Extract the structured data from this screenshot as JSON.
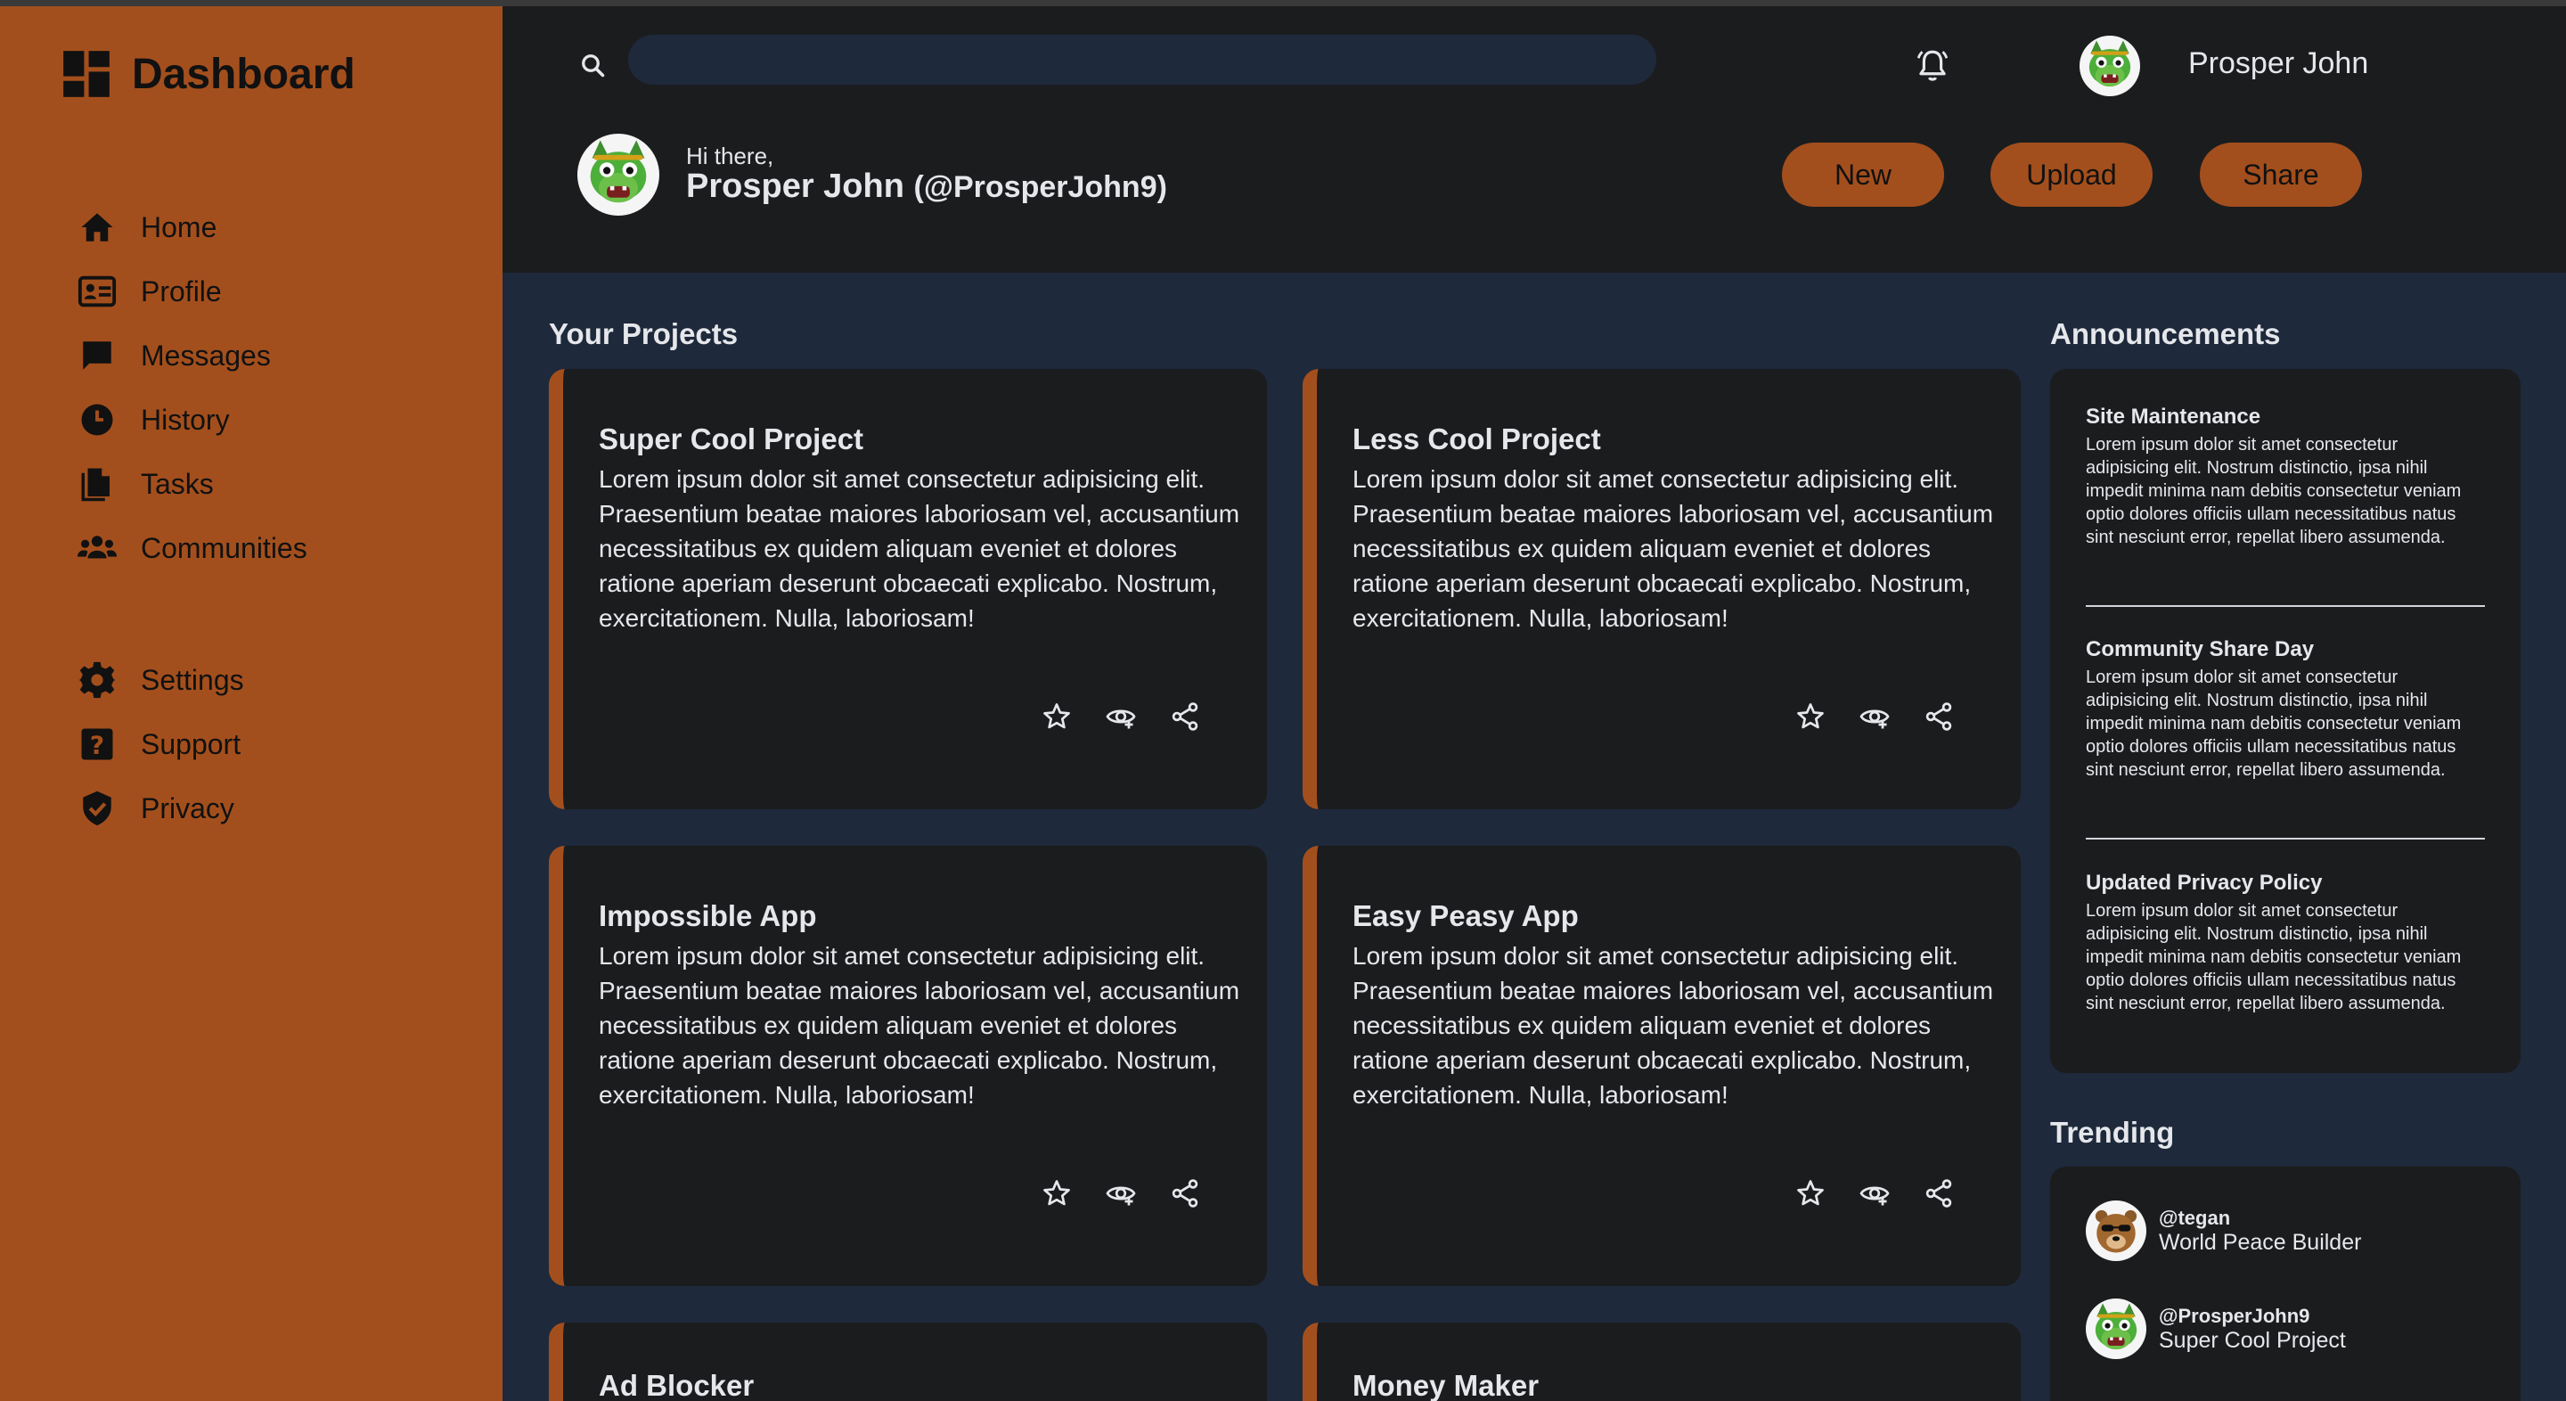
{
  "brand": {
    "title": "Dashboard",
    "icon": "dashboard-grid-icon"
  },
  "nav": {
    "primary": [
      {
        "label": "Home",
        "icon": "home-icon"
      },
      {
        "label": "Profile",
        "icon": "id-card-icon"
      },
      {
        "label": "Messages",
        "icon": "message-icon"
      },
      {
        "label": "History",
        "icon": "clock-icon"
      },
      {
        "label": "Tasks",
        "icon": "document-icon"
      },
      {
        "label": "Communities",
        "icon": "users-icon"
      }
    ],
    "secondary": [
      {
        "label": "Settings",
        "icon": "gear-icon"
      },
      {
        "label": "Support",
        "icon": "help-icon"
      },
      {
        "label": "Privacy",
        "icon": "shield-icon"
      }
    ]
  },
  "header": {
    "search_placeholder": "",
    "user_name": "Prosper John",
    "greeting": "Hi there,",
    "full_name": "Prosper John",
    "handle": "(@ProsperJohn9)",
    "buttons": {
      "new": "New",
      "upload": "Upload",
      "share": "Share"
    }
  },
  "projects": {
    "title": "Your Projects",
    "items": [
      {
        "title": "Super Cool Project",
        "body": "Lorem ipsum dolor sit amet consectetur adipisicing elit. Praesentium beatae maiores laboriosam vel, accusantium necessitatibus ex quidem aliquam eveniet et dolores ratione aperiam deserunt obcaecati explicabo. Nostrum, exercitationem. Nulla, laboriosam!"
      },
      {
        "title": "Less Cool Project",
        "body": "Lorem ipsum dolor sit amet consectetur adipisicing elit. Praesentium beatae maiores laboriosam vel, accusantium necessitatibus ex quidem aliquam eveniet et dolores ratione aperiam deserunt obcaecati explicabo. Nostrum, exercitationem. Nulla, laboriosam!"
      },
      {
        "title": "Impossible App",
        "body": "Lorem ipsum dolor sit amet consectetur adipisicing elit. Praesentium beatae maiores laboriosam vel, accusantium necessitatibus ex quidem aliquam eveniet et dolores ratione aperiam deserunt obcaecati explicabo. Nostrum, exercitationem. Nulla, laboriosam!"
      },
      {
        "title": "Easy Peasy App",
        "body": "Lorem ipsum dolor sit amet consectetur adipisicing elit. Praesentium beatae maiores laboriosam vel, accusantium necessitatibus ex quidem aliquam eveniet et dolores ratione aperiam deserunt obcaecati explicabo. Nostrum, exercitationem. Nulla, laboriosam!"
      },
      {
        "title": "Ad Blocker",
        "body": ""
      },
      {
        "title": "Money Maker",
        "body": ""
      }
    ]
  },
  "announcements": {
    "title": "Announcements",
    "items": [
      {
        "title": "Site Maintenance",
        "body": "Lorem ipsum dolor sit amet consectetur adipisicing elit. Nostrum distinctio, ipsa nihil impedit minima nam debitis consectetur veniam optio dolores officiis ullam necessitatibus natus sint nesciunt error, repellat libero assumenda."
      },
      {
        "title": "Community Share Day",
        "body": "Lorem ipsum dolor sit amet consectetur adipisicing elit. Nostrum distinctio, ipsa nihil impedit minima nam debitis consectetur veniam optio dolores officiis ullam necessitatibus natus sint nesciunt error, repellat libero assumenda."
      },
      {
        "title": "Updated Privacy Policy",
        "body": "Lorem ipsum dolor sit amet consectetur adipisicing elit. Nostrum distinctio, ipsa nihil impedit minima nam debitis consectetur veniam optio dolores officiis ullam necessitatibus natus sint nesciunt error, repellat libero assumenda."
      }
    ]
  },
  "trending": {
    "title": "Trending",
    "items": [
      {
        "handle": "@tegan",
        "desc": "World Peace Builder"
      },
      {
        "handle": "@ProsperJohn9",
        "desc": "Super Cool Project"
      }
    ]
  },
  "colors": {
    "accent": "#a34f1d",
    "header_bg": "#1b1c1e",
    "main_bg": "#1e293b"
  }
}
